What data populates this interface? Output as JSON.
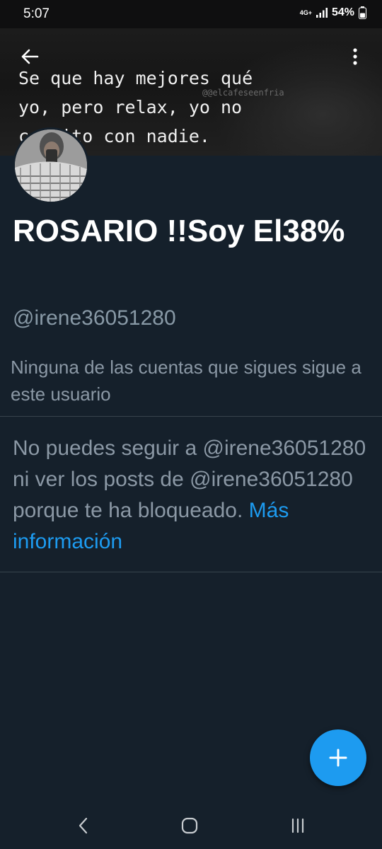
{
  "status_bar": {
    "time": "5:07",
    "network": "4G+",
    "battery": "54%"
  },
  "banner": {
    "quote": "Se que hay mejores qué\nyo, pero relax, yo no\ncompito con nadie.",
    "watermark": "@@elcafeseenfria"
  },
  "profile": {
    "display_name": "ROSARIO !!Soy El38%",
    "handle": "@irene36051280",
    "followers_note": "Ninguna de las cuentas que sigues sigue a este usuario"
  },
  "blocked": {
    "message": "No puedes seguir a @irene36051280 ni ver los posts de @irene36051280 porque te ha bloqueado.",
    "link": "Más información"
  },
  "icons": {
    "back": "back-arrow-icon",
    "more": "more-vertical-icon",
    "compose": "plus-icon",
    "nav_back": "chevron-left-icon",
    "nav_home": "home-circle-icon",
    "nav_recents": "recents-icon"
  },
  "colors": {
    "background": "#15202b",
    "accent": "#1d9bf0",
    "secondary_text": "#8b98a5",
    "divider": "#38444d"
  }
}
